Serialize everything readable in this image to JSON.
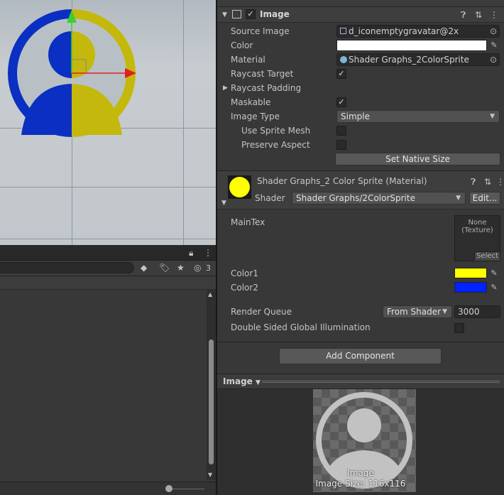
{
  "scene": {
    "tool_active": "move"
  },
  "hierarchy": {
    "hidden_count": "3"
  },
  "image_component": {
    "title": "Image",
    "enabled": true,
    "fields": {
      "source_image_label": "Source Image",
      "source_image_value": "d_iconemptygravatar@2x",
      "color_label": "Color",
      "color_value": "#ffffff",
      "material_label": "Material",
      "material_value": "Shader Graphs_2ColorSprite",
      "raycast_target_label": "Raycast Target",
      "raycast_target_checked": true,
      "raycast_padding_label": "Raycast Padding",
      "maskable_label": "Maskable",
      "maskable_checked": true,
      "image_type_label": "Image Type",
      "image_type_value": "Simple",
      "use_sprite_mesh_label": "Use Sprite Mesh",
      "use_sprite_mesh_checked": false,
      "preserve_aspect_label": "Preserve Aspect",
      "preserve_aspect_checked": false
    },
    "set_native_size_label": "Set Native Size"
  },
  "material": {
    "title": "Shader Graphs_2 Color Sprite (Material)",
    "shader_label": "Shader",
    "shader_value": "Shader Graphs/2ColorSprite",
    "edit_label": "Edit...",
    "preview_color": "#ffff00",
    "maintex_label": "MainTex",
    "maintex_none": "None",
    "maintex_type": "(Texture)",
    "maintex_select": "Select",
    "color1_label": "Color1",
    "color1_value": "#ffff00",
    "color2_label": "Color2",
    "color2_value": "#0022ff",
    "render_queue_label": "Render Queue",
    "render_queue_mode": "From Shader",
    "render_queue_value": "3000",
    "dsgi_label": "Double Sided Global Illumination",
    "dsgi_checked": false
  },
  "add_component_label": "Add Component",
  "preview": {
    "tab_label": "Image",
    "caption_name": "Image",
    "caption_size": "Image Size: 116x116"
  },
  "colors": {
    "yellow": "#c4b80c",
    "blue": "#0a2fc2"
  }
}
